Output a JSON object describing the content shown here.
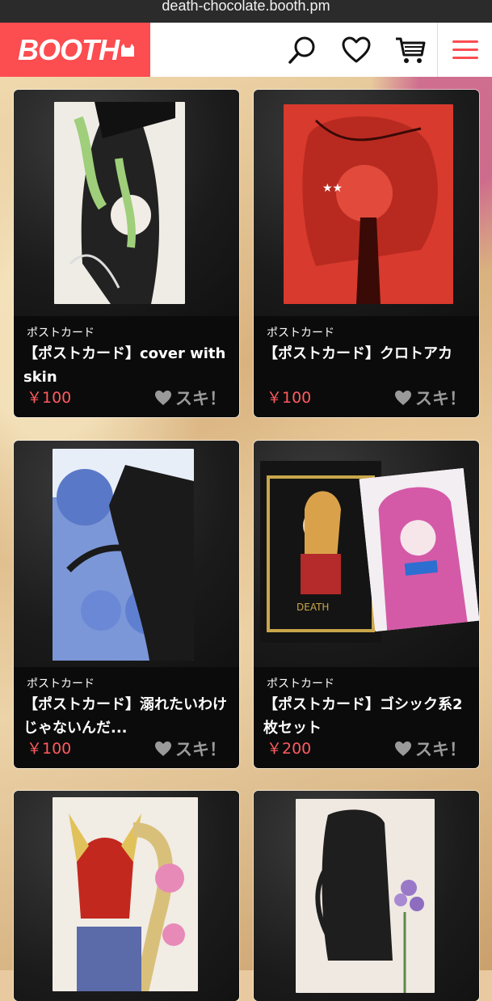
{
  "browser": {
    "url": "death-chocolate.booth.pm"
  },
  "header": {
    "logo": "BOOTH",
    "icons": [
      "search-icon",
      "heart-icon",
      "cart-icon",
      "hamburger-menu-icon"
    ]
  },
  "colors": {
    "brand": "#fc4d50",
    "price": "#ff5a5f",
    "card_bg": "#0b0b0b"
  },
  "products": [
    {
      "category": "ポストカード",
      "title": "【ポストカード】cover with skin",
      "price": "￥100",
      "like": "スキ！"
    },
    {
      "category": "ポストカード",
      "title": "【ポストカード】クロトアカ",
      "price": "￥100",
      "like": "スキ！"
    },
    {
      "category": "ポストカード",
      "title": "【ポストカード】溺れたいわけじゃないんだ...",
      "price": "￥100",
      "like": "スキ！"
    },
    {
      "category": "ポストカード",
      "title": "【ポストカード】ゴシック系2枚セット",
      "price": "￥200",
      "like": "スキ！"
    },
    {
      "category": "",
      "title": "",
      "price": "",
      "like": ""
    },
    {
      "category": "",
      "title": "",
      "price": "",
      "like": ""
    }
  ]
}
